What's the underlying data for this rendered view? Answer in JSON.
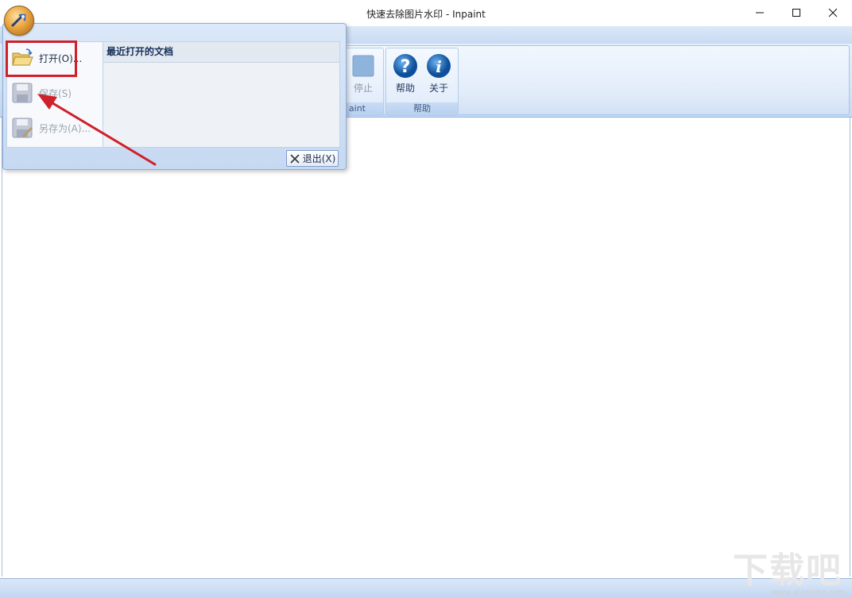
{
  "window": {
    "title": "快速去除图片水印 - Inpaint",
    "minimize_icon": "minimize-icon",
    "maximize_icon": "maximize-icon",
    "close_icon": "close-icon"
  },
  "ribbon": {
    "groups": [
      {
        "label": "aint",
        "buttons": [
          {
            "label": "停止",
            "icon": "stop-icon",
            "enabled": false
          }
        ]
      },
      {
        "label": "帮助",
        "buttons": [
          {
            "label": "帮助",
            "icon": "help-icon",
            "enabled": true
          },
          {
            "label": "关于",
            "icon": "info-icon",
            "enabled": true
          }
        ]
      }
    ]
  },
  "app_menu": {
    "items": [
      {
        "label": "打开(O)...",
        "icon": "open-folder-icon",
        "enabled": true
      },
      {
        "label": "保存(S)",
        "icon": "save-icon",
        "enabled": false
      },
      {
        "label": "另存为(A)...",
        "icon": "save-as-icon",
        "enabled": false
      }
    ],
    "recent_header": "最近打开的文档",
    "exit_label": "退出(X)"
  },
  "watermark": {
    "text": "下载吧",
    "sub": "www.xiazaiba.com"
  },
  "colors": {
    "highlight": "#d0202a",
    "arrow": "#d0202a",
    "help_blue": "#1d6bb8"
  }
}
